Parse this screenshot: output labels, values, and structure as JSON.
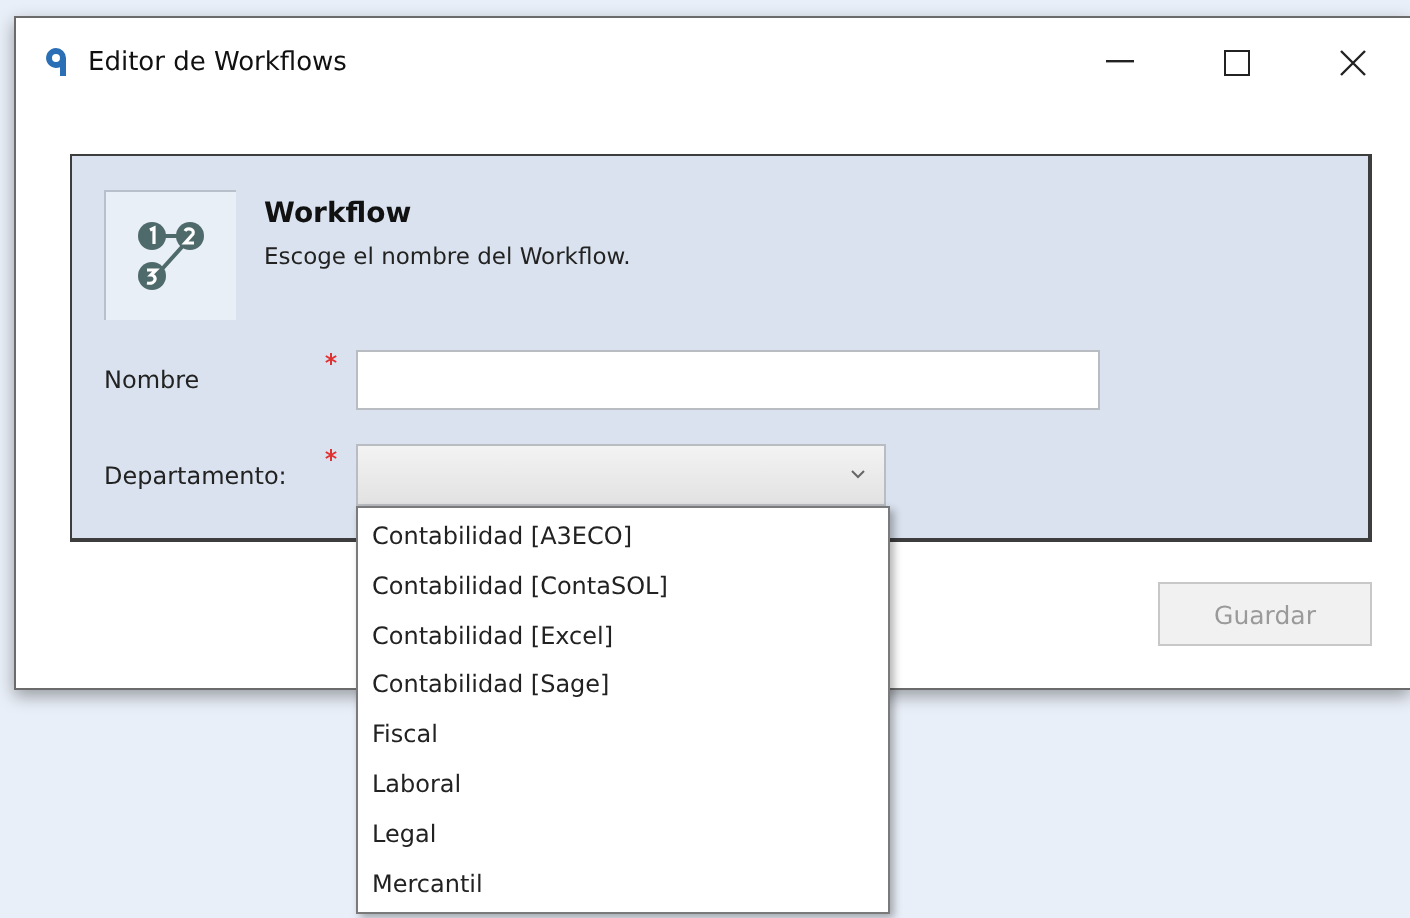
{
  "window": {
    "title": "Editor de Workflows"
  },
  "header": {
    "title": "Workflow",
    "subtitle": "Escoge el nombre del Workflow."
  },
  "fields": [
    {
      "kind": "text",
      "label": "Nombre",
      "required": true
    },
    {
      "kind": "dropdown",
      "label": "Departamento:",
      "required": true,
      "expanded": true,
      "options": [
        {
          "label": "Contabilidad [A3ECO]",
          "selected": false
        },
        {
          "label": "Contabilidad [ContaSOL]",
          "selected": false
        },
        {
          "label": "Contabilidad [Excel]",
          "selected": false
        },
        {
          "label": "Contabilidad [Sage]",
          "selected": false
        },
        {
          "label": "Fiscal",
          "selected": false
        },
        {
          "label": "Laboral",
          "selected": false
        },
        {
          "label": "Legal",
          "selected": false
        },
        {
          "label": "Mercantil",
          "selected": false
        }
      ]
    }
  ],
  "buttons": [
    {
      "label": "Guardar",
      "disabled": true
    }
  ]
}
